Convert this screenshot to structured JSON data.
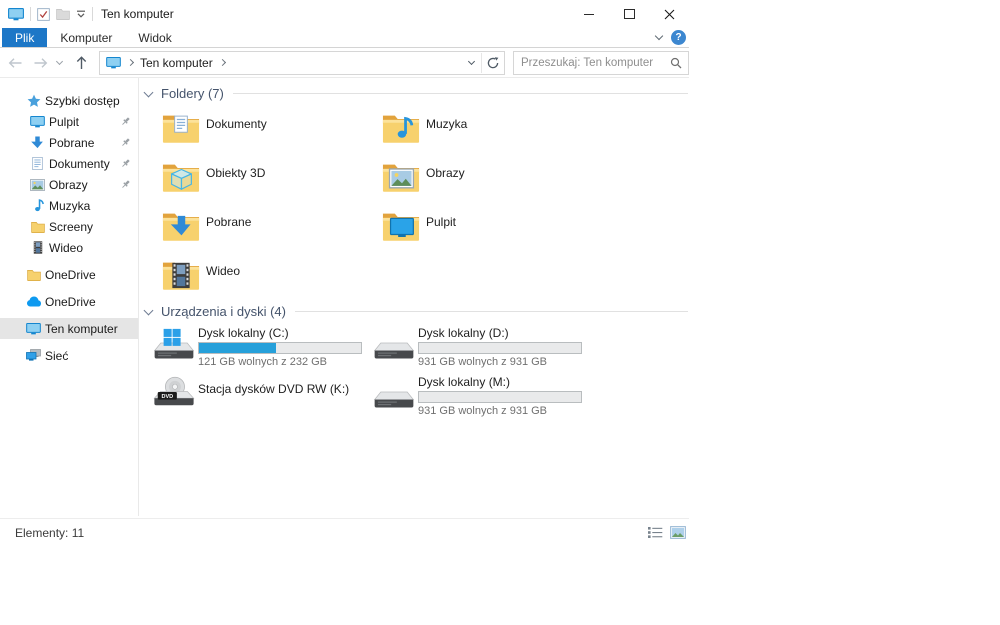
{
  "titlebar": {
    "title": "Ten komputer"
  },
  "ribbon": {
    "tabs": [
      {
        "label": "Plik",
        "active": true
      },
      {
        "label": "Komputer",
        "active": false
      },
      {
        "label": "Widok",
        "active": false
      }
    ],
    "help_label": "?"
  },
  "navbar": {
    "breadcrumb_root": "Ten komputer",
    "search_placeholder": "Przeszukaj: Ten komputer"
  },
  "sidebar": {
    "items": [
      {
        "label": "Szybki dostęp",
        "icon": "quick-access-star",
        "level": 0,
        "pinned": false,
        "selected": false
      },
      {
        "label": "Pulpit",
        "icon": "desktop",
        "level": 1,
        "pinned": true,
        "selected": false
      },
      {
        "label": "Pobrane",
        "icon": "downloads",
        "level": 1,
        "pinned": true,
        "selected": false
      },
      {
        "label": "Dokumenty",
        "icon": "documents",
        "level": 1,
        "pinned": true,
        "selected": false
      },
      {
        "label": "Obrazy",
        "icon": "pictures",
        "level": 1,
        "pinned": true,
        "selected": false
      },
      {
        "label": "Muzyka",
        "icon": "music",
        "level": 1,
        "pinned": false,
        "selected": false
      },
      {
        "label": "Screeny",
        "icon": "folder",
        "level": 1,
        "pinned": false,
        "selected": false
      },
      {
        "label": "Wideo",
        "icon": "videos",
        "level": 1,
        "pinned": false,
        "selected": false
      },
      {
        "label": "OneDrive",
        "icon": "folder",
        "level": 0,
        "pinned": false,
        "selected": false
      },
      {
        "label": "OneDrive",
        "icon": "onedrive-cloud",
        "level": 0,
        "pinned": false,
        "selected": false
      },
      {
        "label": "Ten komputer",
        "icon": "this-pc",
        "level": 0,
        "pinned": false,
        "selected": true
      },
      {
        "label": "Sieć",
        "icon": "network",
        "level": 0,
        "pinned": false,
        "selected": false
      }
    ]
  },
  "content": {
    "sections": [
      {
        "title": "Foldery (7)"
      },
      {
        "title": "Urządzenia i dyski (4)"
      }
    ],
    "folders": [
      {
        "name": "Dokumenty"
      },
      {
        "name": "Muzyka"
      },
      {
        "name": "Obiekty 3D"
      },
      {
        "name": "Obrazy"
      },
      {
        "name": "Pobrane"
      },
      {
        "name": "Pulpit"
      },
      {
        "name": "Wideo"
      }
    ],
    "drives": [
      {
        "name": "Dysk lokalny (C:)",
        "free": "121 GB wolnych z 232 GB",
        "used_width": "47.8%"
      },
      {
        "name": "Dysk lokalny (D:)",
        "free": "931 GB wolnych z 931 GB",
        "used_width": "0%"
      },
      {
        "name": "Stacja dysków DVD RW (K:)"
      },
      {
        "name": "Dysk lokalny (M:)",
        "free": "931 GB wolnych z 931 GB",
        "used_width": "0%"
      }
    ]
  },
  "statusbar": {
    "items_text": "Elementy: 11"
  },
  "colors": {
    "tab_accent": "#1d77c7",
    "drive_bar_fill": "#26a0da",
    "selection_bg": "#e5e5e5",
    "section_header_text": "#44536b",
    "folder_yellow": "#f7d16d",
    "help_blue": "#3c87d0"
  }
}
